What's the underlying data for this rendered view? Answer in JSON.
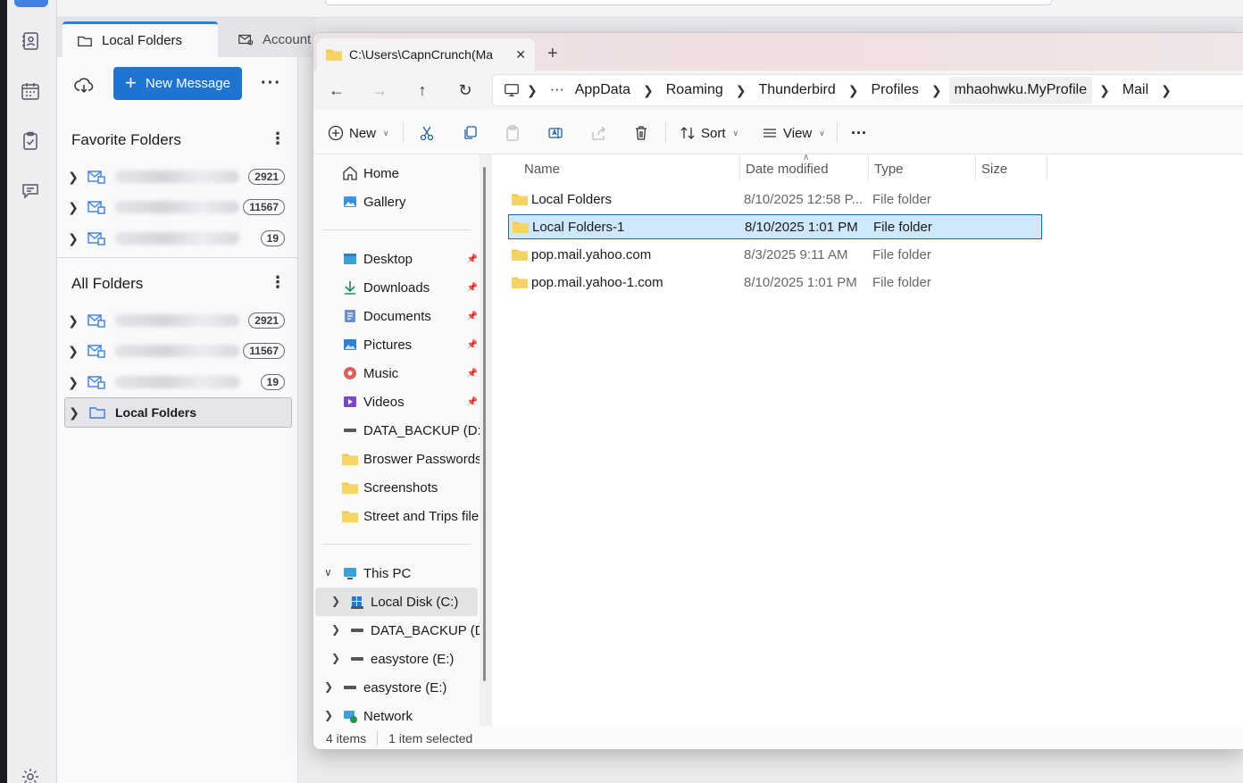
{
  "thunderbird": {
    "tabs": [
      {
        "label": "Local Folders"
      },
      {
        "label": "Account S"
      }
    ],
    "new_message_label": "New Message",
    "favorite_folders_header": "Favorite Folders",
    "all_folders_header": "All Folders",
    "favorite_accounts": [
      {
        "count": "2921"
      },
      {
        "count": "11567"
      },
      {
        "count": "19"
      }
    ],
    "all_accounts": [
      {
        "count": "2921"
      },
      {
        "count": "11567"
      },
      {
        "count": "19"
      }
    ],
    "local_folders_label": "Local Folders",
    "more_glyph": "···",
    "kebab_glyph": "⋮",
    "accent_color": "#1f73d1"
  },
  "explorer": {
    "tab_title": "C:\\Users\\CapnCrunch(Ma",
    "close_glyph": "✕",
    "new_tab_glyph": "+",
    "breadcrumbs": [
      "AppData",
      "Roaming",
      "Thunderbird",
      "Profiles",
      "mhaohwku.MyProfile",
      "Mail"
    ],
    "toolbar": {
      "new_label": "New",
      "sort_label": "Sort",
      "view_label": "View",
      "more_glyph": "···"
    },
    "sidebar": {
      "quick": [
        {
          "label": "Home"
        },
        {
          "label": "Gallery"
        }
      ],
      "pinned": [
        {
          "label": "Desktop"
        },
        {
          "label": "Downloads"
        },
        {
          "label": "Documents"
        },
        {
          "label": "Pictures"
        },
        {
          "label": "Music"
        },
        {
          "label": "Videos"
        }
      ],
      "other": [
        {
          "label": "DATA_BACKUP (D:)"
        },
        {
          "label": "Broswer Passwords_"
        },
        {
          "label": "Screenshots"
        },
        {
          "label": "Street and Trips files"
        }
      ],
      "this_pc": "This PC",
      "drives": [
        {
          "label": "Local Disk (C:)"
        },
        {
          "label": "DATA_BACKUP (D:"
        },
        {
          "label": "easystore (E:)"
        }
      ],
      "easystore": "easystore (E:)",
      "network": "Network"
    },
    "columns": {
      "name": "Name",
      "date": "Date modified",
      "type": "Type",
      "size": "Size"
    },
    "files": [
      {
        "name": "Local Folders",
        "date": "8/10/2025 12:58 P...",
        "type": "File folder"
      },
      {
        "name": "Local Folders-1",
        "date": "8/10/2025 1:01 PM",
        "type": "File folder"
      },
      {
        "name": "pop.mail.yahoo.com",
        "date": "8/3/2025 9:11 AM",
        "type": "File folder"
      },
      {
        "name": "pop.mail.yahoo-1.com",
        "date": "8/10/2025 1:01 PM",
        "type": "File folder"
      }
    ],
    "status": {
      "items": "4 items",
      "selected": "1 item selected"
    },
    "selection_color": "#cde8ff",
    "folder_color": "#f2c94c"
  }
}
